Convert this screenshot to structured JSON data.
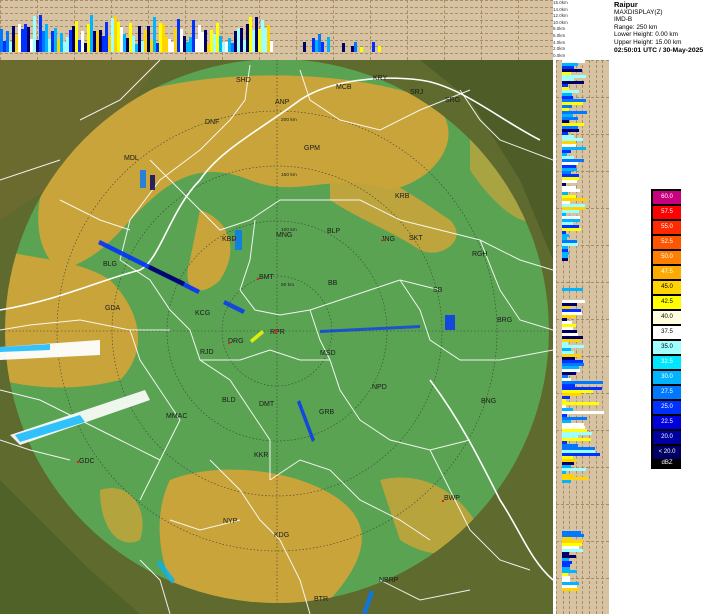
{
  "info": {
    "station": "Raipur",
    "product": "MAXDISPLAY(Z)",
    "agency": "IMD-B",
    "range": "Range: 250 km",
    "lower_height": "Lower Height: 0.00 km",
    "upper_height": "Upper Height: 15.00 km",
    "timestamp": "02:50:01 UTC / 30-May-2025"
  },
  "height_scale": [
    "15.0km",
    "14.0km",
    "12.0km",
    "10.0km",
    "8.0km",
    "6.0km",
    "4.0km",
    "2.0km",
    "0.0km"
  ],
  "legend": {
    "unit": "dBZ",
    "levels": [
      {
        "label": "60.0",
        "color": "#c8007f"
      },
      {
        "label": "57.5",
        "color": "#ff0000"
      },
      {
        "label": "55.0",
        "color": "#ff2a00"
      },
      {
        "label": "52.5",
        "color": "#ff5500"
      },
      {
        "label": "50.0",
        "color": "#ff7f00"
      },
      {
        "label": "47.5",
        "color": "#ffaa00"
      },
      {
        "label": "45.0",
        "color": "#ffd400"
      },
      {
        "label": "42.5",
        "color": "#ffff00"
      },
      {
        "label": "40.0",
        "color": "#fffde0"
      },
      {
        "label": "37.5",
        "color": "#ffffff"
      },
      {
        "label": "35.0",
        "color": "#a0ffff"
      },
      {
        "label": "32.5",
        "color": "#00e6ff"
      },
      {
        "label": "30.0",
        "color": "#00b4ff"
      },
      {
        "label": "27.5",
        "color": "#0078ff"
      },
      {
        "label": "25.0",
        "color": "#0032ff"
      },
      {
        "label": "22.5",
        "color": "#0000dc"
      },
      {
        "label": "20.0",
        "color": "#0000a0"
      },
      {
        "label": "< 20.0",
        "color": "#000064"
      }
    ]
  },
  "range_rings": [
    "50 km",
    "100 km",
    "150 km",
    "200 km"
  ],
  "radar_center": {
    "code": "RPR"
  },
  "stations": [
    {
      "code": "SHD"
    },
    {
      "code": "ANP"
    },
    {
      "code": "MCB"
    },
    {
      "code": "KRY"
    },
    {
      "code": "SRJ"
    },
    {
      "code": "SRG"
    },
    {
      "code": "DNF"
    },
    {
      "code": "GPM"
    },
    {
      "code": "MDL"
    },
    {
      "code": "KRB"
    },
    {
      "code": "KBD"
    },
    {
      "code": "MNG"
    },
    {
      "code": "BLP"
    },
    {
      "code": "JNG"
    },
    {
      "code": "SKT"
    },
    {
      "code": "RGH"
    },
    {
      "code": "BLG"
    },
    {
      "code": "BMT"
    },
    {
      "code": "BB"
    },
    {
      "code": "SB"
    },
    {
      "code": "GDA"
    },
    {
      "code": "KCG"
    },
    {
      "code": "BRG"
    },
    {
      "code": "DRG"
    },
    {
      "code": "RJD"
    },
    {
      "code": "MSD"
    },
    {
      "code": "NPD"
    },
    {
      "code": "MMAC"
    },
    {
      "code": "BLD"
    },
    {
      "code": "DMT"
    },
    {
      "code": "GRB"
    },
    {
      "code": "BNG"
    },
    {
      "code": "GDC"
    },
    {
      "code": "KKR"
    },
    {
      "code": "BWP"
    },
    {
      "code": "NYP"
    },
    {
      "code": "KDG"
    },
    {
      "code": "NBRP"
    },
    {
      "code": "BTR"
    }
  ],
  "colors": {
    "terrain_green": "#5aa352",
    "terrain_yellow": "#c9a43a",
    "outside_range": "#59602a",
    "side_panel": "#d7c3a2",
    "boundary": "#ffffff"
  }
}
